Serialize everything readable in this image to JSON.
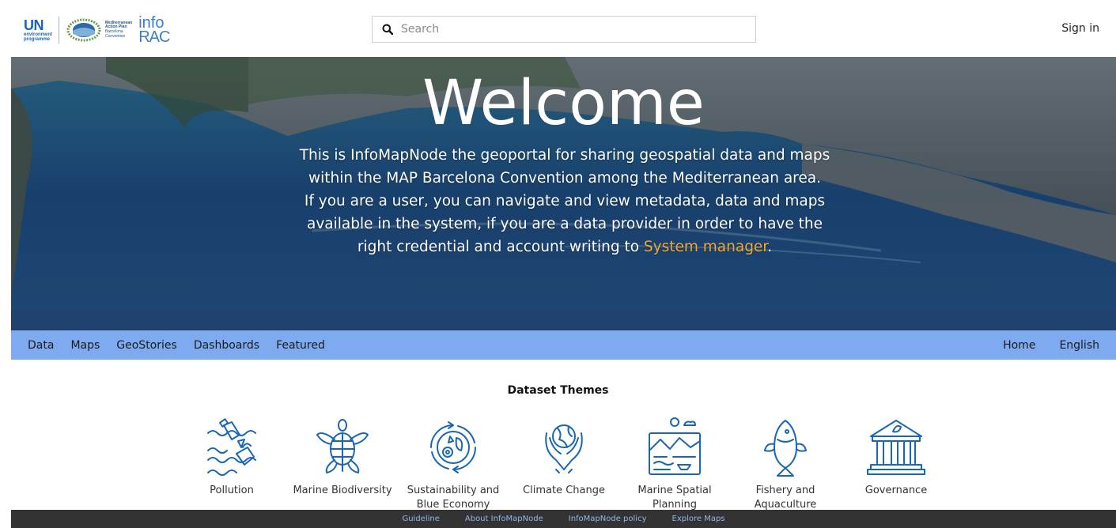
{
  "header": {
    "logo_un": "UN",
    "logo_un_sub1": "environment",
    "logo_un_sub2": "programme",
    "logo_map_line1": "Mediterranean",
    "logo_map_line2": "Action Plan",
    "logo_map_line3": "Barcelona",
    "logo_map_line4": "Convention",
    "logo_info_1": "info",
    "logo_info_2": "RAC",
    "search_placeholder": "Search",
    "sign_in": "Sign in"
  },
  "hero": {
    "title": "Welcome",
    "text_part1": "This is InfoMapNode the geoportal for sharing geospatial data and maps within the MAP Barcelona Convention among the Mediterranean area.",
    "text_part2": "If you are a user, you can navigate and view metadata, data and maps available in the system, if you are a data provider in order to have the right credential and account writing to ",
    "link": "System manager",
    "text_end": "."
  },
  "nav": {
    "left": [
      "Data",
      "Maps",
      "GeoStories",
      "Dashboards",
      "Featured"
    ],
    "right": [
      "Home",
      "English"
    ]
  },
  "themes": {
    "title": "Dataset Themes",
    "items": [
      {
        "label": "Pollution",
        "icon": "pollution-icon"
      },
      {
        "label": "Marine Biodiversity",
        "icon": "turtle-icon"
      },
      {
        "label": "Sustainability and Blue Economy",
        "icon": "sustainability-icon"
      },
      {
        "label": "Climate Change",
        "icon": "climate-icon"
      },
      {
        "label": "Marine Spatial Planning",
        "icon": "spatial-planning-icon"
      },
      {
        "label": "Fishery and Aquaculture",
        "icon": "fish-icon"
      },
      {
        "label": "Governance",
        "icon": "governance-icon"
      }
    ]
  },
  "footer": {
    "links": [
      "Guideline",
      "About InfoMapNode",
      "InfoMapNode policy",
      "Explore Maps"
    ]
  },
  "colors": {
    "nav_bg": "#7eaaf0",
    "icon": "#1a67b1",
    "link_accent": "#f0a838",
    "footer_bg": "#333333",
    "footer_link": "#8fb6ec"
  }
}
